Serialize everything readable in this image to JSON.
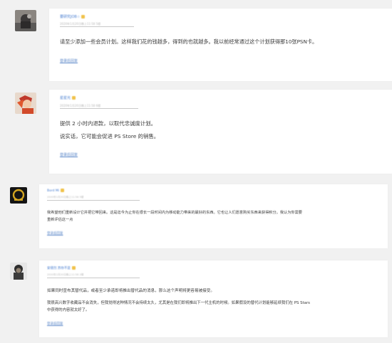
{
  "comments": [
    {
      "author": "要研究JOB☆",
      "meta": "2020年1月20日晚上11:58  5楼",
      "paragraphs": [
        "请至少添加一些会员计划。这样我们花的钱越多，得到的也就越多。我以前经常通过这个计划获得那10张PSN卡。"
      ],
      "reply": "登录后回复",
      "badge_color": "#f0c24a"
    },
    {
      "author": "星星光",
      "meta": "2020年1月20日晚上11:58  6楼",
      "paragraphs": [
        "提供 2 小时内退款，以取代忠诚度计划。",
        "说实话，它可能会促进 PS Store 的销售。"
      ],
      "reply": "登录后回复",
      "badge_color": "#f0c24a"
    },
    {
      "author": "Bord Mi",
      "meta": "2020年1月20日晚上11:58  5楼",
      "paragraphs": [
        "我希望他们重新设计它并把它带回来。这是迄今为止你在很长一段时间内为移动能力带来的最好的东西。它也让人们愿意购买东西来获得积分。我认为你需要",
        "重新评估这一点"
      ],
      "reply": "登录后回复",
      "badge_color": "#f0c24a"
    },
    {
      "author": "安德烈 苏你不是",
      "meta": "2020年1月20日晚上11:58  2楼",
      "paragraphs": [
        "如果同时宣布其替代品，或者至少承诺即将推出替代品的消息，那么这个声明将更容易被接受。",
        "我很高兴数字收藏品不会消失，但我觉得这种情况不会持续太久，尤其是在我们即将推出下一代主机的时候。如果假设的替代计划能够延续我们在 PS Stars",
        "中获得的内容就太好了。"
      ],
      "reply": "登录后回复",
      "badge_color": "#f0c24a"
    }
  ]
}
